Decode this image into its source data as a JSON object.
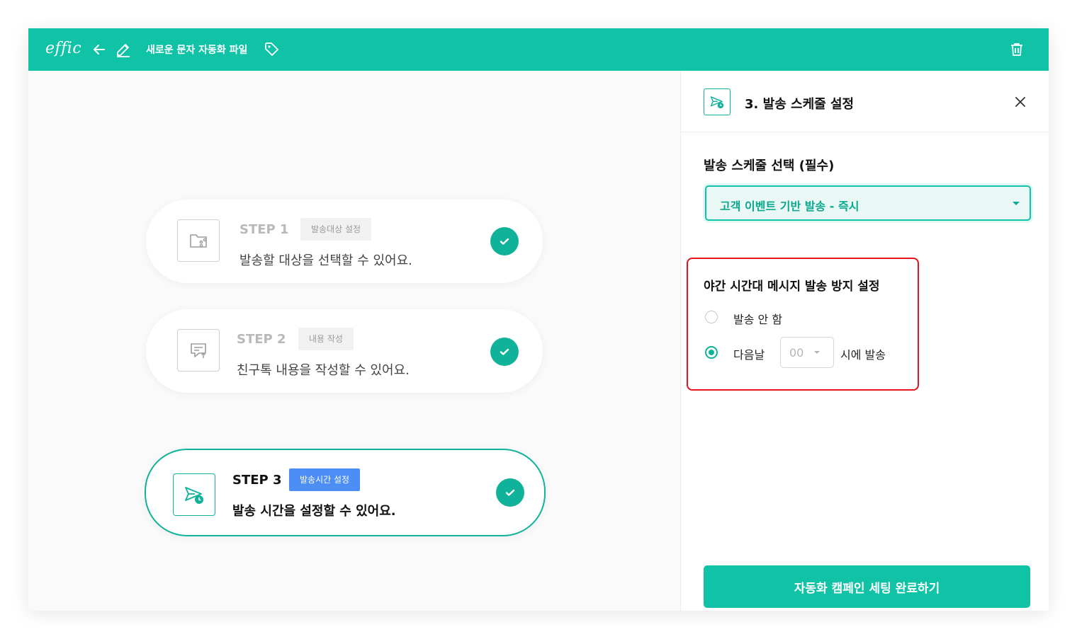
{
  "colors": {
    "brand": "#10c2a6",
    "accent": "#10b39a",
    "badge_active": "#4c8df6",
    "highlight": "#e5141c"
  },
  "header": {
    "logo": "effic",
    "file_title": "새로운 문자 자동화 파일",
    "icons": [
      "arrow-left-icon",
      "pencil-icon",
      "tag-icon",
      "trash-icon"
    ]
  },
  "steps": [
    {
      "title": "STEP 1",
      "badge": "발송대상 설정",
      "desc": "발송할 대상을 선택할 수 있어요.",
      "icon": "folder-share-icon",
      "completed": true,
      "active": false
    },
    {
      "title": "STEP 2",
      "badge": "내용 작성",
      "desc": "친구톡 내용을 작성할 수 있어요.",
      "icon": "message-edit-icon",
      "completed": true,
      "active": false
    },
    {
      "title": "STEP 3",
      "badge": "발송시간 설정",
      "desc": "발송 시간을 설정할 수 있어요.",
      "icon": "send-clock-icon",
      "completed": true,
      "active": true
    }
  ],
  "panel": {
    "title": "3. 발송 스케줄 설정",
    "schedule_label": "발송 스케줄 선택 (필수)",
    "schedule_value": "고객 이벤트 기반 발송 - 즉시",
    "night": {
      "label": "야간 시간대 메시지 발송 방지 설정",
      "option_none": "발송 안 함",
      "option_next": "다음날",
      "hour_value": "00",
      "suffix": "시에 발송",
      "selected": "next"
    },
    "complete_button": "자동화 캠페인 세팅 완료하기"
  }
}
